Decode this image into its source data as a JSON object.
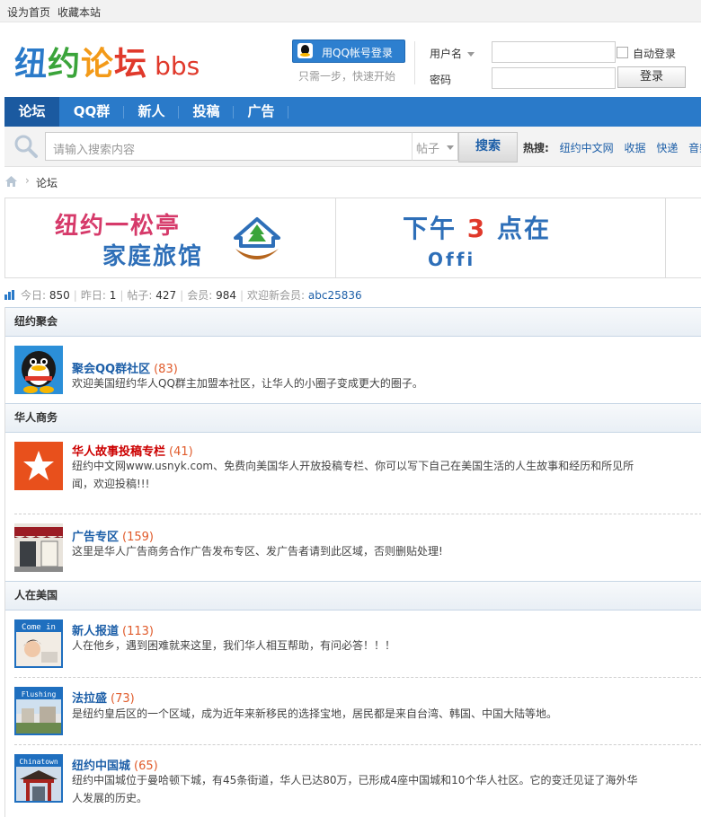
{
  "topbar": {
    "set_home": "设为首页",
    "bookmark": "收藏本站"
  },
  "logo": {
    "c1": "纽",
    "c2": "约",
    "c3": "论",
    "c4": "坛",
    "bbs": "bbs"
  },
  "login": {
    "qq_button": "用QQ帐号登录",
    "qq_hint": "只需一步，快速开始",
    "username_label": "用户名",
    "password_label": "密码",
    "auto_login": "自动登录",
    "login_button": "登录",
    "username_value": "",
    "password_value": ""
  },
  "nav": {
    "items": [
      "论坛",
      "QQ群",
      "新人",
      "投稿",
      "广告"
    ],
    "active": 0
  },
  "search": {
    "placeholder": "请输入搜索内容",
    "type": "帖子",
    "button": "搜索",
    "hot_label": "热搜:",
    "hot": [
      "纽约中文网",
      "收据",
      "快递",
      "音樂中"
    ]
  },
  "breadcrumb": {
    "current": "论坛"
  },
  "banner": {
    "ad1_line1": "纽约一松亭",
    "ad1_line2": "家庭旅馆",
    "ad2_a": "下午",
    "ad2_num": "3",
    "ad2_b": "点在",
    "ad2_line2": "Offi"
  },
  "stats": {
    "today_label": "今日:",
    "today": "850",
    "yesterday_label": "昨日:",
    "yesterday": "1",
    "posts_label": "帖子:",
    "posts": "427",
    "members_label": "会员:",
    "members": "984",
    "welcome_label": "欢迎新会员:",
    "newest_member": "abc25836"
  },
  "categories": [
    {
      "title": "纽约聚会",
      "forums": [
        {
          "name": "聚会QQ群社区",
          "count": "(83)",
          "desc": "欢迎美国纽约华人QQ群主加盟本社区，让华人的小圈子变成更大的圈子。",
          "highlight": false,
          "icon": "qq-penguin-icon"
        }
      ]
    },
    {
      "title": "华人商务",
      "forums": [
        {
          "name": "华人故事投稿专栏",
          "count": "(41)",
          "desc": "纽约中文网www.usnyk.com、免费向美国华人开放投稿专栏、你可以写下自己在美国生活的人生故事和经历和所见所闻，欢迎投稿!!!",
          "highlight": true,
          "icon": "star-icon"
        },
        {
          "name": "广告专区",
          "count": "(159)",
          "desc": "这里是华人广告商务合作广告发布专区、发广告者请到此区域，否则删贴处理!",
          "highlight": false,
          "icon": "storefront-icon"
        }
      ]
    },
    {
      "title": "人在美国",
      "forums": [
        {
          "name": "新人报道",
          "count": "(113)",
          "desc": "人在他乡，遇到困难就来这里，我们华人相互帮助，有问必答！！！",
          "highlight": false,
          "icon": "come-in-icon",
          "icon_text": "Come in"
        },
        {
          "name": "法拉盛",
          "count": "(73)",
          "desc": "是纽约皇后区的一个区域，成为近年来新移民的选择宝地，居民都是来自台湾、韩国、中国大陆等地。",
          "highlight": false,
          "icon": "flushing-icon",
          "icon_text": "Flushing"
        },
        {
          "name": "纽约中国城",
          "count": "(65)",
          "desc": "纽约中国城位于曼哈顿下城，有45条街道，华人已达80万，已形成4座中国城和10个华人社区。它的变迁见证了海外华人发展的历史。",
          "highlight": false,
          "icon": "chinatown-icon",
          "icon_text": "Chinatown"
        }
      ]
    }
  ]
}
